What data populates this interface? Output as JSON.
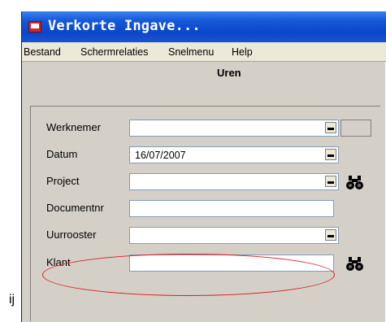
{
  "window": {
    "title": "Verkorte Ingave..."
  },
  "menu": [
    {
      "label": "Bestand"
    },
    {
      "label": "Schermrelaties"
    },
    {
      "label": "Snelmenu"
    },
    {
      "label": "Help"
    }
  ],
  "form": {
    "title": "Uren",
    "fields": {
      "werknemer": {
        "label": "Werknemer",
        "value": ""
      },
      "datum": {
        "label": "Datum",
        "value": "16/07/2007"
      },
      "project": {
        "label": "Project",
        "value": ""
      },
      "documentnr": {
        "label": "Documentnr",
        "value": ""
      },
      "uurrooster": {
        "label": "Uurrooster",
        "value": ""
      },
      "klant": {
        "label": "Klant",
        "value": ""
      }
    }
  },
  "stray_text": "ij",
  "colors": {
    "titlebar": "#0b46c8",
    "highlight_ellipse": "#e0191e"
  },
  "icons": [
    "app-icon",
    "binoculars-icon",
    "chevron-down-icon"
  ]
}
